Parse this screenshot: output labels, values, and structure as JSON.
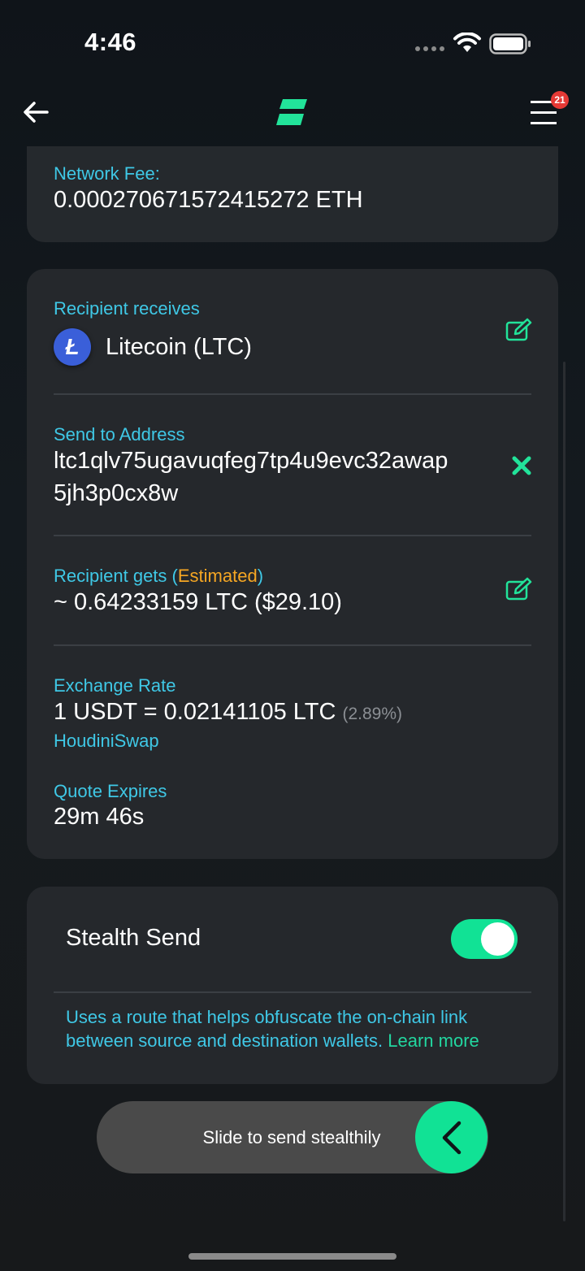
{
  "status_bar": {
    "time": "4:46"
  },
  "nav": {
    "notifications_count": "21",
    "back_icon": "arrow-left-icon",
    "menu_icon": "hamburger-menu-icon"
  },
  "fee": {
    "label": "Network Fee:",
    "value": "0.000270671572415272 ETH"
  },
  "recipient_receives": {
    "label": "Recipient receives",
    "coin_name": "Litecoin (LTC)",
    "coin_symbol": "Ł"
  },
  "send_address": {
    "label": "Send to Address",
    "line1": "ltc1qlv75ugavuqfeg7tp4u9evc32awap",
    "line2": "5jh3p0cx8w"
  },
  "recipient_gets": {
    "label_prefix": "Recipient gets (",
    "label_estimated": "Estimated",
    "label_suffix": ")",
    "value": "~ 0.64233159 LTC ($29.10)"
  },
  "exchange_rate": {
    "label": "Exchange Rate",
    "value": "1 USDT = 0.02141105 LTC",
    "percent": "(2.89%)",
    "provider": "HoudiniSwap"
  },
  "quote": {
    "label": "Quote Expires",
    "value": "29m 46s"
  },
  "stealth": {
    "title": "Stealth Send",
    "enabled": true,
    "description": "Uses a route that helps obfuscate the on-chain link between source and destination wallets.",
    "learn_more": "Learn more"
  },
  "slider": {
    "label": "Slide to send stealthily"
  },
  "colors": {
    "accent_green": "#11e295",
    "label_cyan": "#3fc8e6",
    "estimated_orange": "#f5a623",
    "card_bg": "#25282c"
  }
}
